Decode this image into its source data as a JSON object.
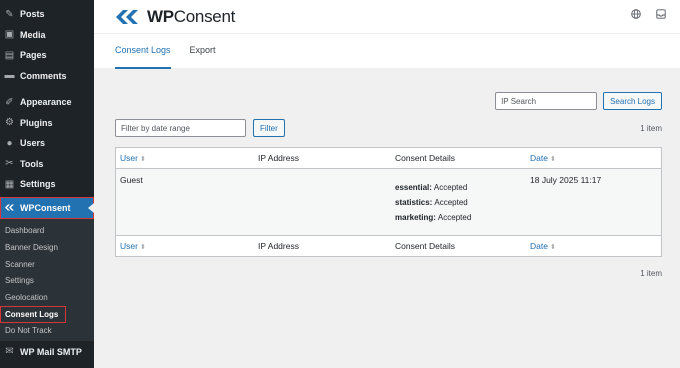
{
  "sidebar": {
    "items": [
      {
        "label": "Posts",
        "icon": "pin-icon"
      },
      {
        "label": "Media",
        "icon": "media-icon"
      },
      {
        "label": "Pages",
        "icon": "pages-icon"
      },
      {
        "label": "Comments",
        "icon": "comments-icon"
      }
    ],
    "items2": [
      {
        "label": "Appearance",
        "icon": "appearance-icon"
      },
      {
        "label": "Plugins",
        "icon": "plugins-icon"
      },
      {
        "label": "Users",
        "icon": "users-icon"
      },
      {
        "label": "Tools",
        "icon": "tools-icon"
      },
      {
        "label": "Settings",
        "icon": "settings-icon"
      }
    ],
    "current": {
      "label": "WPConsent",
      "icon": "wpconsent-icon"
    },
    "submenu": [
      "Dashboard",
      "Banner Design",
      "Scanner",
      "Settings",
      "Geolocation",
      "Consent Logs",
      "Do Not Track"
    ],
    "bottom": {
      "label": "WP Mail SMTP",
      "icon": "mail-icon"
    }
  },
  "header": {
    "logo_text_bold": "WP",
    "logo_text": "Consent"
  },
  "tabs": [
    "Consent Logs",
    "Export"
  ],
  "search": {
    "placeholder": "IP Search",
    "button": "Search Logs"
  },
  "filter": {
    "placeholder": "Filter by date range",
    "button": "Filter"
  },
  "item_count": "1 item",
  "table": {
    "columns": [
      "User",
      "IP Address",
      "Consent Details",
      "Date"
    ],
    "rows": [
      {
        "user": "Guest",
        "ip": "",
        "details": [
          {
            "key": "essential:",
            "value": "Accepted"
          },
          {
            "key": "statistics:",
            "value": "Accepted"
          },
          {
            "key": "marketing:",
            "value": "Accepted"
          }
        ],
        "date": "18 July 2025 11:17"
      }
    ]
  },
  "colors": {
    "accent": "#2271b1",
    "sidebar_bg": "#1d2327",
    "highlight_border": "#d63638"
  }
}
